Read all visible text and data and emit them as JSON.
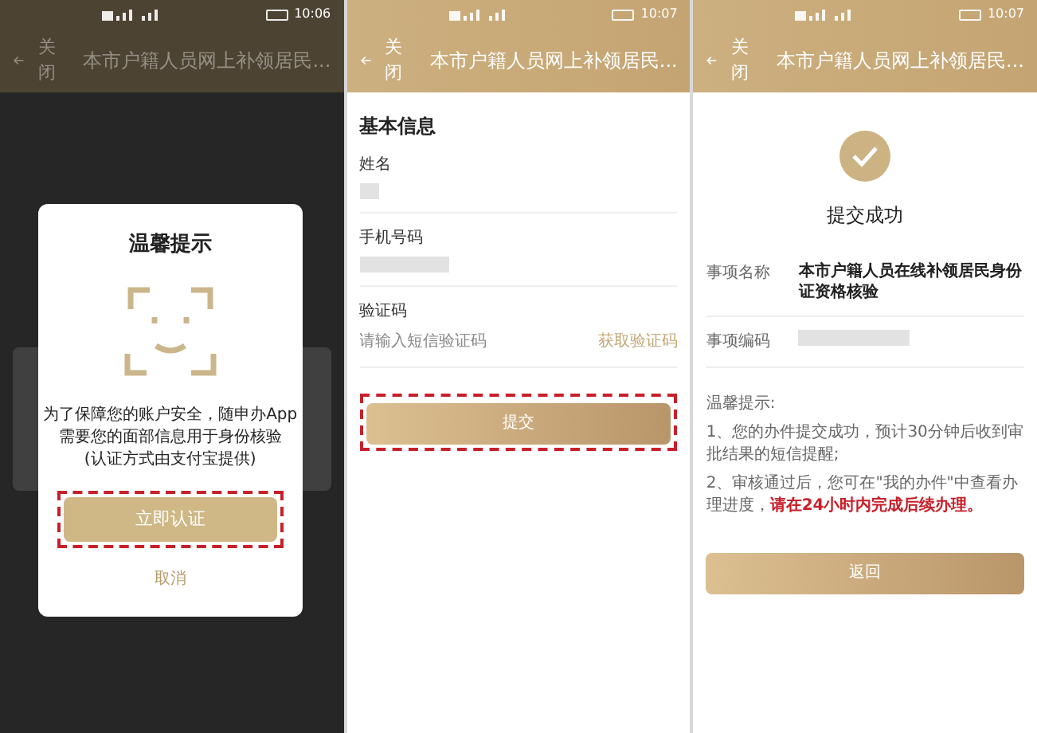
{
  "screens": [
    {
      "kind": "dialog",
      "dimmed": true,
      "status_time": "10:06",
      "back_label": "关闭",
      "title": "本市户籍人员网上补领居民...",
      "dialog": {
        "title": "温馨提示",
        "message": [
          "为了保障您的账户安全，随申办App",
          "需要您的面部信息用于身份核验",
          "(认证方式由支付宝提供)"
        ],
        "primary_button": {
          "label": "立即认证",
          "highlighted": true
        },
        "cancel_label": "取消"
      }
    },
    {
      "kind": "form",
      "dimmed": false,
      "status_time": "10:07",
      "back_label": "关闭",
      "title": "本市户籍人员网上补领居民...",
      "section_title": "基本信息",
      "fields": [
        {
          "kind": "masked",
          "label": "姓名"
        },
        {
          "kind": "masked",
          "label": "手机号码"
        },
        {
          "kind": "input",
          "label": "验证码",
          "placeholder": "请输入短信验证码",
          "action": "获取验证码"
        }
      ],
      "submit_button": {
        "label": "提交",
        "highlighted": true
      }
    },
    {
      "kind": "success",
      "dimmed": false,
      "status_time": "10:07",
      "back_label": "关闭",
      "title": "本市户籍人员网上补领居民...",
      "result_title": "提交成功",
      "details": [
        {
          "kind": "text",
          "label": "事项名称",
          "value": "本市户籍人员在线补领居民身份证资格核验"
        },
        {
          "kind": "masked",
          "label": "事项编码"
        }
      ],
      "hints_title": "温馨提示:",
      "hints": [
        {
          "text": "1、您的办件提交成功，预计30分钟后收到审批结果的短信提醒;"
        },
        {
          "text": "2、审核通过后，您可在\"我的办件\"中查看办理进度，",
          "emphasis": "请在24小时内完成后续办理。"
        }
      ],
      "back_button": {
        "label": "返回",
        "highlighted": false
      }
    }
  ]
}
